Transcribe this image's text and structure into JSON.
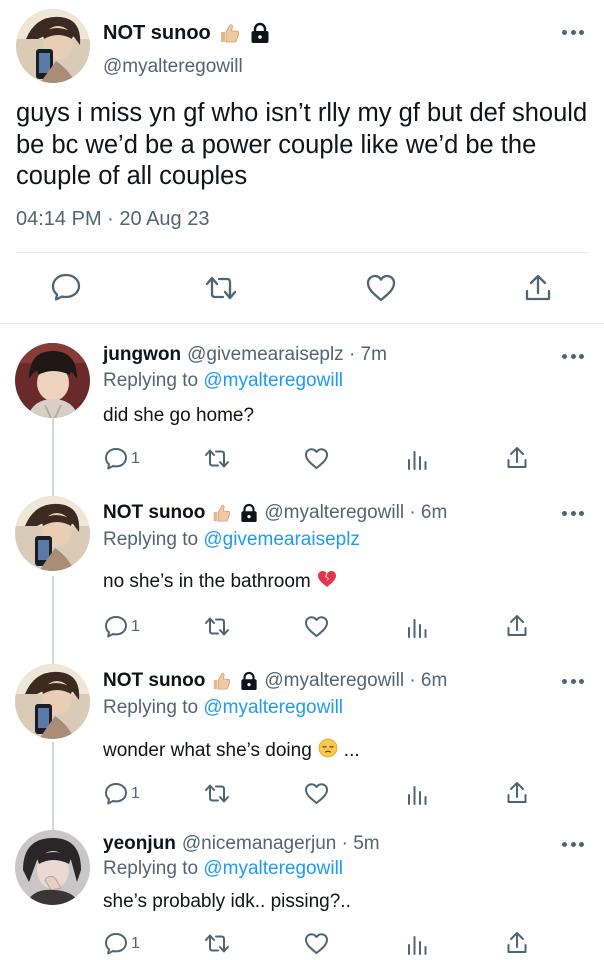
{
  "main_tweet": {
    "display_name": "NOT sunoo",
    "handle": "@myalteregowill",
    "text": "guys i miss yn gf who isn’t rlly my gf but def should be bc we’d be a power couple like we’d be the couple of all couples",
    "timestamp": "04:14 PM · 20 Aug 23",
    "icons": [
      "thumbs-up-icon",
      "lock-icon",
      "more-icon",
      "reply-icon",
      "retweet-icon",
      "like-icon",
      "share-icon"
    ]
  },
  "replies": [
    {
      "display_name": "jungwon",
      "meta": "@givemearaiseplz · 7m",
      "replying_prefix": "Replying to",
      "replying_to": "@myalteregowill",
      "text": "did she go home?",
      "reply_count": "1",
      "emoji": ""
    },
    {
      "display_name": "NOT sunoo",
      "meta": "@myalteregowill · 6m",
      "replying_prefix": "Replying to",
      "replying_to": "@givemearaiseplz",
      "text": "no she’s in the bathroom",
      "reply_count": "1",
      "emoji": "broken-heart"
    },
    {
      "display_name": "NOT sunoo",
      "meta": "@myalteregowill · 6m",
      "replying_prefix": "Replying to",
      "replying_to": "@myalteregowill",
      "text": "wonder what she’s doing",
      "text_suffix": "...",
      "reply_count": "1",
      "emoji": "pensive-face"
    },
    {
      "display_name": "yeonjun",
      "meta": "@nicemanagerjun · 5m",
      "replying_prefix": "Replying to",
      "replying_to": "@myalteregowill",
      "text": "she’s probably idk.. pissing?..",
      "reply_count": "1",
      "emoji": ""
    }
  ],
  "colors": {
    "text": "#0f1419",
    "secondary": "#536471",
    "link": "#1d9bf0",
    "divider": "#e1e8ed",
    "thread_line": "#cfd9de"
  }
}
